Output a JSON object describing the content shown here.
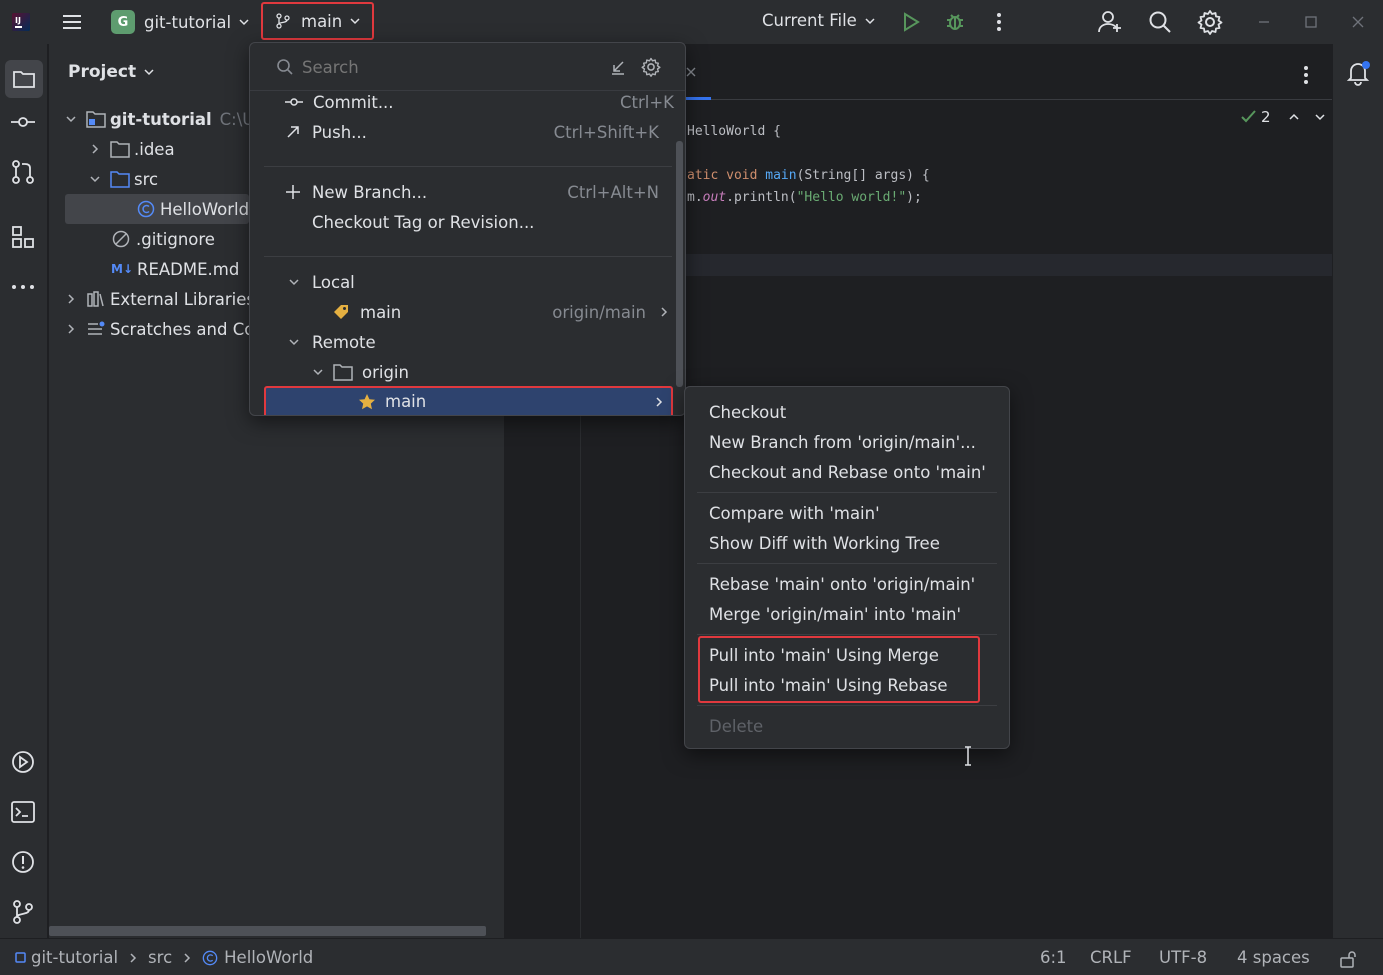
{
  "titlebar": {
    "project_badge": "G",
    "project_name": "git-tutorial",
    "branch": "main",
    "run_config": "Current File"
  },
  "project_panel": {
    "title": "Project",
    "tree": [
      {
        "label": "git-tutorial",
        "extra": "C:\\U"
      },
      {
        "label": ".idea"
      },
      {
        "label": "src"
      },
      {
        "label": "HelloWorld"
      },
      {
        "label": ".gitignore"
      },
      {
        "label": "README.md",
        "badge": "M↓"
      },
      {
        "label": "External Libraries"
      },
      {
        "label": "Scratches and Co"
      }
    ]
  },
  "editor": {
    "inspection_count": "2",
    "lines": [
      "HelloWorld {",
      "",
      "atic void main(String[] args) {",
      "m.out.println(\"Hello world!\");"
    ]
  },
  "branch_popup": {
    "search_placeholder": "Search",
    "actions": [
      {
        "label": "Commit...",
        "shortcut": "Ctrl+K"
      },
      {
        "label": "Push...",
        "shortcut": "Ctrl+Shift+K"
      },
      {
        "label": "New Branch...",
        "shortcut": "Ctrl+Alt+N"
      },
      {
        "label": "Checkout Tag or Revision...",
        "shortcut": ""
      }
    ],
    "local_label": "Local",
    "local_branch": "main",
    "local_tracking": "origin/main",
    "remote_label": "Remote",
    "remote_name": "origin",
    "remote_branch": "main"
  },
  "context_menu": {
    "items": [
      "Checkout",
      "New Branch from 'origin/main'...",
      "Checkout and Rebase onto 'main'",
      "Compare with 'main'",
      "Show Diff with Working Tree",
      "Rebase 'main' onto 'origin/main'",
      "Merge 'origin/main' into 'main'",
      "Pull into 'main' Using Merge",
      "Pull into 'main' Using Rebase",
      "Delete"
    ]
  },
  "statusbar": {
    "breadcrumb": [
      "git-tutorial",
      "src",
      "HelloWorld"
    ],
    "position": "6:1",
    "line_sep": "CRLF",
    "encoding": "UTF-8",
    "indent": "4 spaces"
  },
  "colors": {
    "highlight_red": "#e0393e",
    "selection_blue": "#2e436e",
    "run_green": "#57965c",
    "accent_blue": "#3574f0"
  }
}
